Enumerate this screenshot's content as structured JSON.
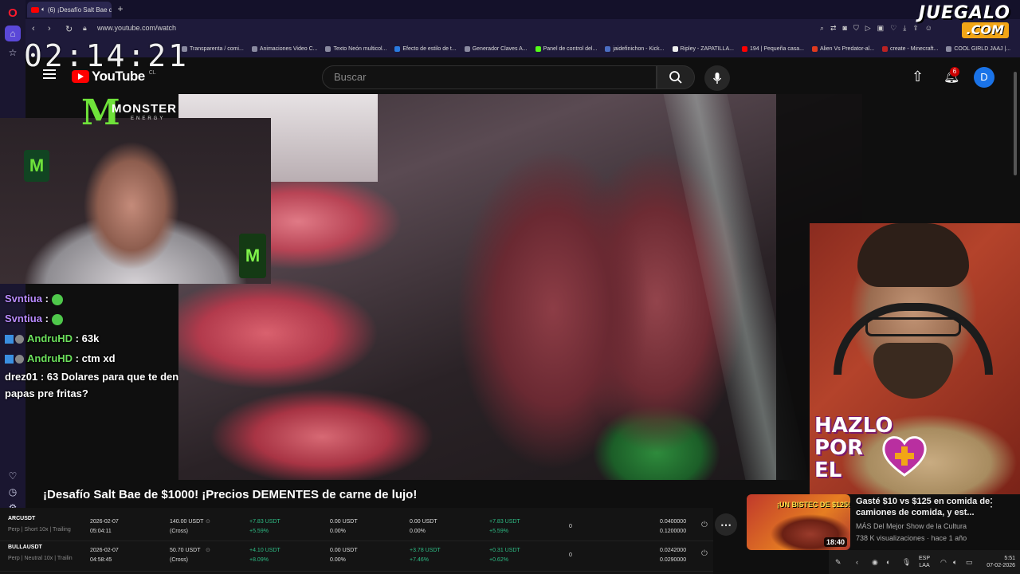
{
  "browser": {
    "tab_title": "(6) ¡Desafío Salt Bae d",
    "url": "www.youtube.com/watch",
    "bookmarks": [
      "Transparenta / comi...",
      "Animaciones Video C...",
      "Texto Neón multicol...",
      "Efecto de estilo de t...",
      "Generador Claves A...",
      "Panel de control del...",
      "jaidefinichon - Kick...",
      "Ripley - ZAPATILLA...",
      "194 | Pequeña casa...",
      "Alien Vs Predator-al...",
      "create - Minecraft...",
      "COOL GIRLD JAAJ |..."
    ]
  },
  "watermark": {
    "top": "JUEGALO",
    "bottom": ".COM"
  },
  "clock": "02:14:21",
  "youtube": {
    "logo_text": "YouTube",
    "country": "CL",
    "search_placeholder": "Buscar",
    "notifications": "6",
    "avatar_letter": "D",
    "video_title": "¡Desafío Salt Bae de $1000! ¡Precios DEMENTES de carne de lujo!"
  },
  "overlay": {
    "monster_brand": "MONSTER",
    "monster_sub": "ENERGY",
    "hazlo": [
      "HAZLO",
      "POR",
      "EL"
    ]
  },
  "chat": [
    {
      "user": "Svntiua",
      "message": ""
    },
    {
      "user": "Svntiua",
      "message": ""
    },
    {
      "user": "AndruHD",
      "message": ": 63k"
    },
    {
      "user": "AndruHD",
      "message": ": ctm xd"
    },
    {
      "user": "drez01",
      "message": ": 63 Dolares para que te den papas pre fritas?"
    }
  ],
  "trading": [
    {
      "symbol": "ARCUSDT",
      "detail": "Perp | Short 10x | Trailing",
      "date": "2026-02-07",
      "time": "05:04:11",
      "amount": "140.00 USDT",
      "mode": "(Cross)",
      "pnl1": "+7.83 USDT",
      "pnl1_pct": "+5.59%",
      "v2": "0.00 USDT",
      "v2_pct": "0.00%",
      "v3": "0.00 USDT",
      "v3_pct": "0.00%",
      "pnl4": "+7.83 USDT",
      "pnl4_pct": "+5.59%",
      "count": "0",
      "price1": "0.0400000",
      "price2": "0.1200000"
    },
    {
      "symbol": "BULLAUSDT",
      "detail": "Perp | Neutral 10x | Trailin",
      "date": "2026-02-07",
      "time": "04:58:45",
      "amount": "50.70 USDT",
      "mode": "(Cross)",
      "pnl1": "+4.10 USDT",
      "pnl1_pct": "+8.09%",
      "v2": "0.00 USDT",
      "v2_pct": "0.00%",
      "v3": "+3.78 USDT",
      "v3_pct": "+7.46%",
      "pnl4": "+0.31 USDT",
      "pnl4_pct": "+0.62%",
      "count": "0",
      "price1": "0.0242000",
      "price2": "0.0290000"
    }
  ],
  "recommendation": {
    "thumb_text": "¡UN BISTEC DE $125!",
    "duration": "18:40",
    "title": "Gasté $10 vs $125 en comida de camiones de comida, y est...",
    "channel": "MÁS Del Mejor Show de la Cultura",
    "meta": "738 K visualizaciones · hace 1 año"
  },
  "taskbar": {
    "lang1": "ESP",
    "lang2": "LAA",
    "time": "5:51",
    "date": "07-02-2026"
  },
  "colors": {
    "youtube_red": "#ff0000",
    "opera_sidebar": "#1a1630",
    "monster_green": "#6fe23a",
    "profit_green": "#2ebd85",
    "juegalo_orange": "#f2a516"
  }
}
